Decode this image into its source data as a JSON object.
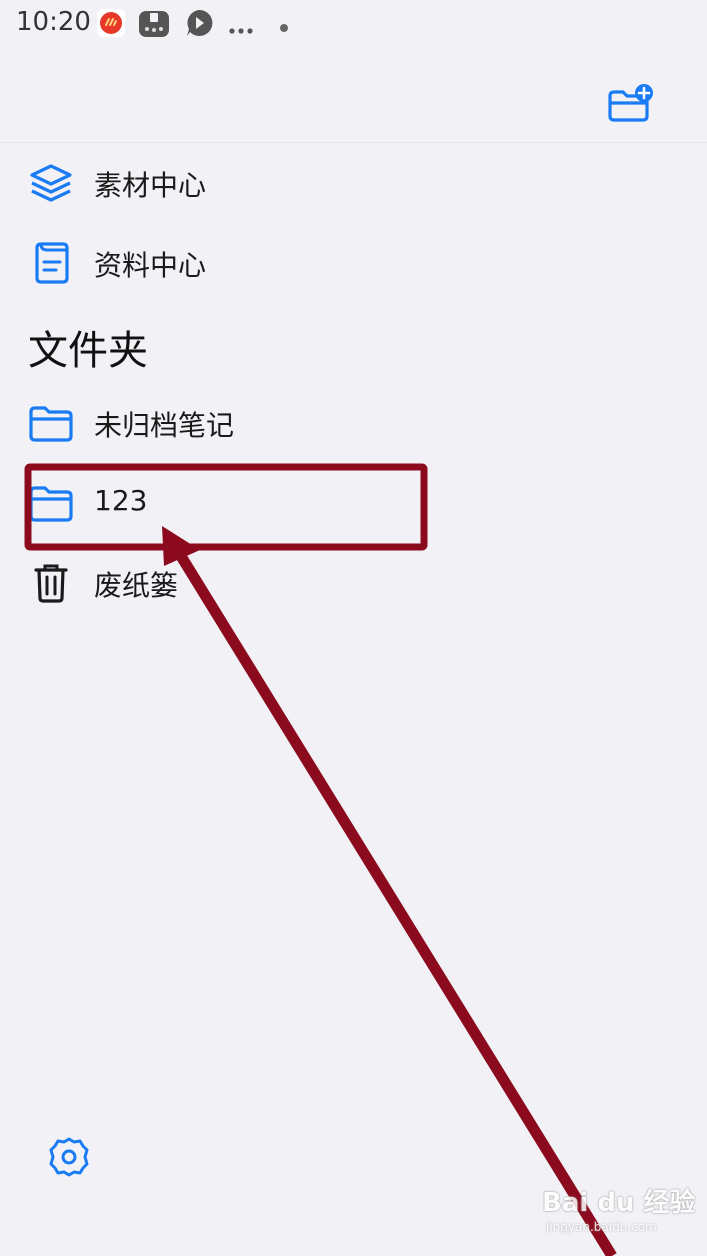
{
  "status_bar": {
    "time": "10:20",
    "icons": [
      "app-notification-icon",
      "game-controller-icon",
      "video-bubble-icon",
      "more-dots-icon",
      "dot-icon"
    ]
  },
  "header": {
    "new_folder_icon": "folder-plus-icon"
  },
  "nav": [
    {
      "label": "素材中心",
      "icon": "layers-icon"
    },
    {
      "label": "资料中心",
      "icon": "document-icon"
    }
  ],
  "folders_section": {
    "title": "文件夹",
    "items": [
      {
        "label": "未归档笔记",
        "icon": "folder-icon"
      },
      {
        "label": "123",
        "icon": "folder-icon",
        "highlighted": true
      },
      {
        "label": "废纸篓",
        "icon": "trash-icon"
      }
    ]
  },
  "footer": {
    "settings_icon": "gear-icon"
  },
  "watermark": {
    "brand": "Bai du 经验",
    "url": "jingyan.baidu.com"
  },
  "colors": {
    "accent": "#1a7cf5",
    "background": "#f2f1f6",
    "annotation": "#8b0a1e"
  }
}
